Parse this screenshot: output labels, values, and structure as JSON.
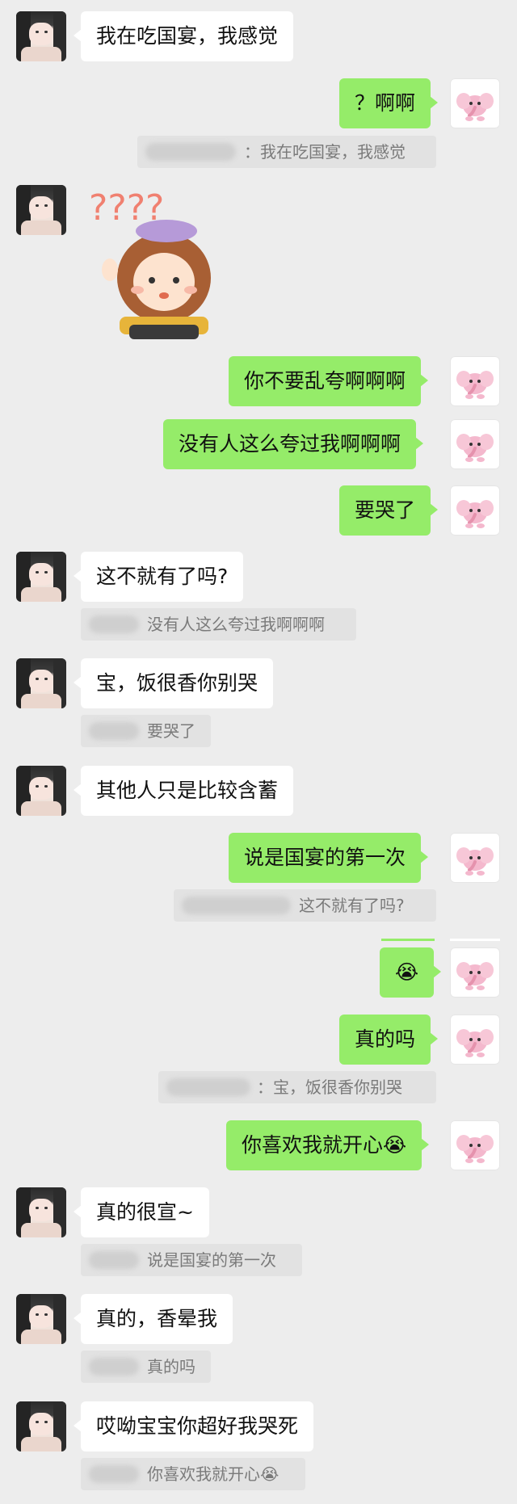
{
  "colors": {
    "background": "#ededed",
    "self_bubble": "#95ec69",
    "other_bubble": "#ffffff",
    "quote_bg": "#e2e2e2",
    "quote_text": "#7a7a7a"
  },
  "avatars": {
    "other": "girl-photo-avatar",
    "self": "pink-elephant-avatar"
  },
  "messages": [
    {
      "side": "left",
      "text": "我在吃国宴，我感觉"
    },
    {
      "side": "right",
      "text": "？啊啊",
      "quote": "：我在吃国宴，我感觉"
    },
    {
      "side": "left",
      "type": "sticker",
      "icon": "question-marks-girl-sticker",
      "sticker_text": "????"
    },
    {
      "side": "right",
      "text": "你不要乱夸啊啊啊"
    },
    {
      "side": "right",
      "text": "没有人这么夸过我啊啊啊"
    },
    {
      "side": "right",
      "text": "要哭了"
    },
    {
      "side": "left",
      "text": "这不就有了吗?",
      "quote": "没有人这么夸过我啊啊啊"
    },
    {
      "side": "left",
      "text": "宝，饭很香你别哭",
      "quote": "要哭了"
    },
    {
      "side": "left",
      "text": "其他人只是比较含蓄"
    },
    {
      "side": "right",
      "text": "说是国宴的第一次",
      "quote": "这不就有了吗?"
    },
    {
      "side": "right",
      "text": "😭"
    },
    {
      "side": "right",
      "text": "真的吗",
      "quote": "：宝，饭很香你别哭"
    },
    {
      "side": "right",
      "text": "你喜欢我就开心😭"
    },
    {
      "side": "left",
      "text": "真的很宣~",
      "quote": "说是国宴的第一次"
    },
    {
      "side": "left",
      "text": "真的，香晕我",
      "quote": "真的吗"
    },
    {
      "side": "left",
      "text": "哎呦宝宝你超好我哭死",
      "quote": "你喜欢我就开心😭"
    }
  ]
}
